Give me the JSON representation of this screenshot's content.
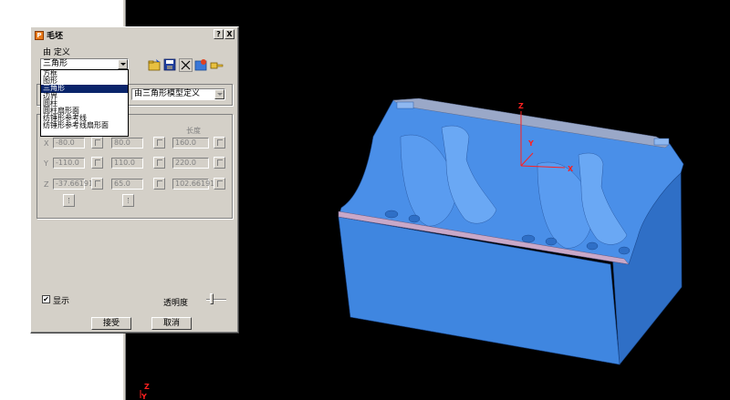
{
  "dialog": {
    "title": "毛坯",
    "help_label": "?",
    "close_label": "X",
    "menu_text": "由   定义",
    "combo_value": "三角形",
    "dropdown_options": [
      "方框",
      "图形",
      "三角形",
      "边界",
      "圆柱",
      "圆柱扇形面",
      "纺锤形参考线",
      "纺锤形参考线扇形面"
    ],
    "selected_index": 2,
    "secondary_combo_value": "由三角形模型定义",
    "coord_header": "长度",
    "axes": [
      "X",
      "Y",
      "Z"
    ],
    "rows": [
      {
        "min": "-80.0",
        "max": "80.0",
        "len": "160.0"
      },
      {
        "min": "-110.0",
        "max": "110.0",
        "len": "220.0"
      },
      {
        "min": "-37.66191",
        "max": "65.0",
        "len": "102.66191"
      }
    ],
    "show_label": "显示",
    "show_checked": "✔",
    "transparency_label": "透明度",
    "accept_label": "接受",
    "cancel_label": "取消"
  },
  "viewport": {
    "axis_x": "X",
    "axis_y": "Y",
    "axis_z": "Z",
    "corner_z": "Z",
    "corner_y": "Y"
  },
  "colors": {
    "model_fill": "#4a8fe8",
    "model_shadow": "#2f6fc6",
    "axis_red": "#ff2020",
    "dialog_bg": "#d4d0c8",
    "selection": "#0a246a"
  }
}
